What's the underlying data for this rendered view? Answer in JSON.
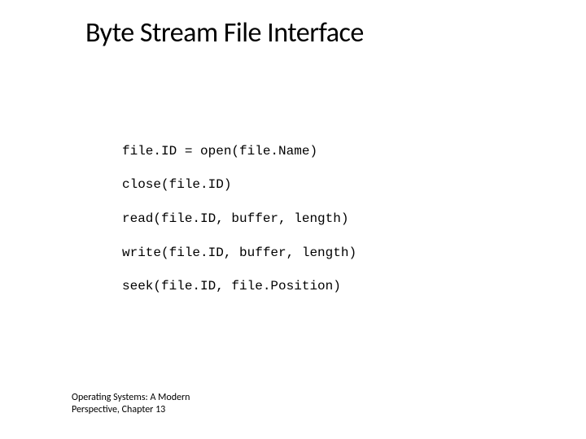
{
  "title": "Byte Stream File Interface",
  "code": {
    "line1": "file.ID = open(file.Name)",
    "line2": "close(file.ID)",
    "line3": "read(file.ID, buffer, length)",
    "line4": "write(file.ID, buffer, length)",
    "line5": "seek(file.ID, file.Position)"
  },
  "footer": {
    "line1": "Operating Systems: A Modern",
    "line2": "Perspective, Chapter 13"
  }
}
